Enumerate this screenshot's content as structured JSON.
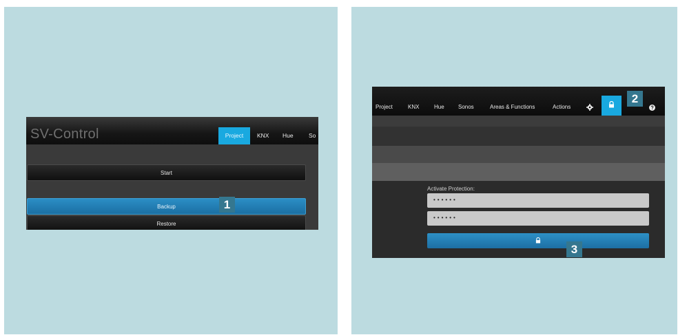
{
  "left": {
    "app_title": "SV-Control",
    "tabs": [
      {
        "label": "Project",
        "active": true
      },
      {
        "label": "KNX",
        "active": false
      },
      {
        "label": "Hue",
        "active": false
      },
      {
        "label": "So",
        "active": false
      }
    ],
    "buttons": {
      "start": "Start",
      "backup": "Backup",
      "restore": "Restore"
    },
    "callout": "1"
  },
  "right": {
    "tabs": [
      {
        "label": "Project"
      },
      {
        "label": "KNX"
      },
      {
        "label": "Hue"
      },
      {
        "label": "Sonos"
      },
      {
        "label": "Areas & Functions"
      },
      {
        "label": "Actions"
      }
    ],
    "icons": [
      "gear-icon",
      "lock-icon",
      "help-icon"
    ],
    "protection": {
      "label": "Activate Protection:",
      "password": "••••••",
      "password_repeat": "••••••"
    },
    "callouts": {
      "tab": "2",
      "button": "3"
    }
  },
  "colors": {
    "background": "#bcdbe0",
    "accent": "#19a9e0",
    "callout": "#35778f"
  }
}
